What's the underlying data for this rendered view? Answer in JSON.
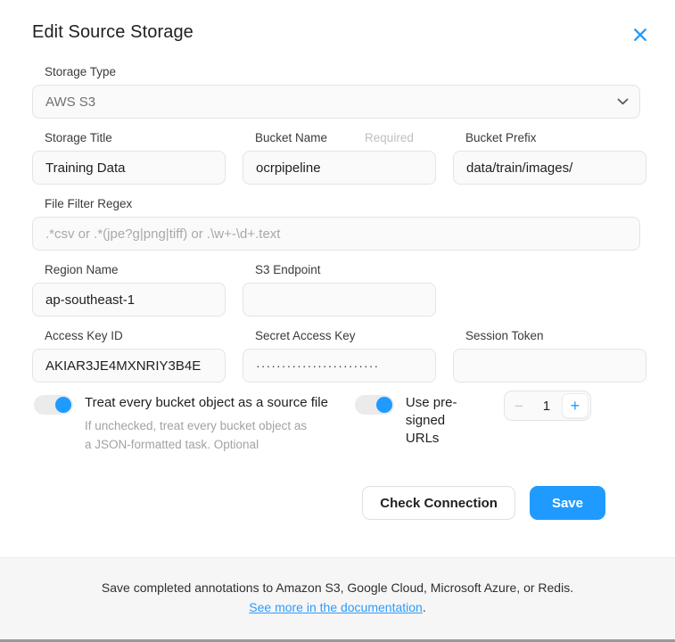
{
  "modal": {
    "title": "Edit Source Storage",
    "close_icon": "close-icon"
  },
  "fields": {
    "storage_type": {
      "label": "Storage Type",
      "value": "AWS S3",
      "chevron_icon": "chevron-down-icon"
    },
    "storage_title": {
      "label": "Storage Title",
      "value": "Training Data",
      "placeholder": ""
    },
    "bucket_name": {
      "label": "Bucket Name",
      "required_hint": "Required",
      "value": "ocrpipeline",
      "placeholder": ""
    },
    "bucket_prefix": {
      "label": "Bucket Prefix",
      "value": "data/train/images/",
      "placeholder": ""
    },
    "file_filter_regex": {
      "label": "File Filter Regex",
      "value": "",
      "placeholder": ".*csv or .*(jpe?g|png|tiff) or .\\w+-\\d+.text"
    },
    "region_name": {
      "label": "Region Name",
      "value": "ap-southeast-1",
      "placeholder": ""
    },
    "s3_endpoint": {
      "label": "S3 Endpoint",
      "value": "",
      "placeholder": ""
    },
    "access_key_id": {
      "label": "Access Key ID",
      "value": "AKIAR3JE4MXNRIY3B4E",
      "placeholder": ""
    },
    "secret_access_key": {
      "label": "Secret Access Key",
      "value": "························",
      "placeholder": ""
    },
    "session_token": {
      "label": "Session Token",
      "value": "",
      "placeholder": ""
    }
  },
  "toggles": {
    "treat_every_object": {
      "label": "Treat every bucket object as a source file",
      "hint": "If unchecked, treat every bucket object as a JSON-formatted task. Optional",
      "state": "on"
    },
    "use_presigned_urls": {
      "label": "Use pre-signed URLs",
      "state": "on"
    }
  },
  "stepper": {
    "minus_label": "−",
    "value": "1",
    "plus_label": "+"
  },
  "actions": {
    "check_connection": "Check Connection",
    "save": "Save"
  },
  "footer": {
    "text": "Save completed annotations to Amazon S3, Google Cloud, Microsoft Azure, or Redis.",
    "link_text": "See more in the documentation",
    "link_suffix": "."
  },
  "colors": {
    "accent": "#1f9bff",
    "link": "#2b9cfc",
    "field_bg": "#fafafa",
    "field_border": "#e3e4e6",
    "footer_bg": "#f6f6f6",
    "muted_text": "#a2a2a5"
  }
}
